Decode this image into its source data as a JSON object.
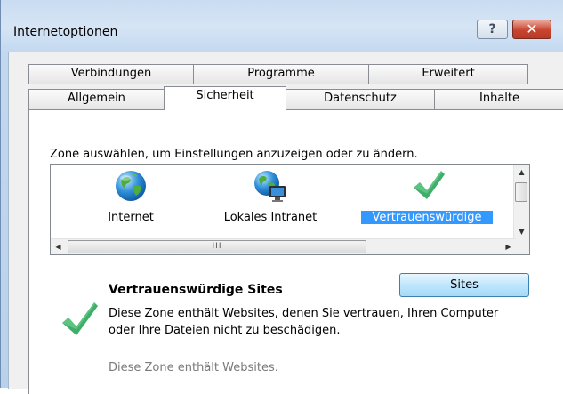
{
  "window": {
    "title": "Internetoptionen",
    "help_label": "?",
    "close_label": "✕"
  },
  "tabs": {
    "row_back": [
      "Verbindungen",
      "Programme",
      "Erweitert"
    ],
    "row_front": [
      "Allgemein",
      "Sicherheit",
      "Datenschutz",
      "Inhalte"
    ],
    "selected": "Sicherheit"
  },
  "security": {
    "zone_prompt": "Zone auswählen, um Einstellungen anzuzeigen oder zu ändern.",
    "zones": [
      {
        "label": "Internet",
        "icon": "globe-icon"
      },
      {
        "label": "Lokales Intranet",
        "icon": "intranet-globe-icon"
      },
      {
        "label": "Vertrauenswürdige",
        "icon": "checkmark-icon",
        "selected": true
      }
    ],
    "hscroll_grip": "III",
    "selected_zone": {
      "title": "Vertrauenswürdige Sites",
      "description": "Diese Zone enthält Websites, denen Sie vertrauen, Ihren Computer oder Ihre Dateien nicht zu beschädigen.",
      "more": "Diese Zone enthält Websites."
    },
    "sites_button": "Sites"
  },
  "colors": {
    "selection": "#3399ff",
    "check_green": "#3fae6a",
    "close_red": "#c9442f"
  }
}
